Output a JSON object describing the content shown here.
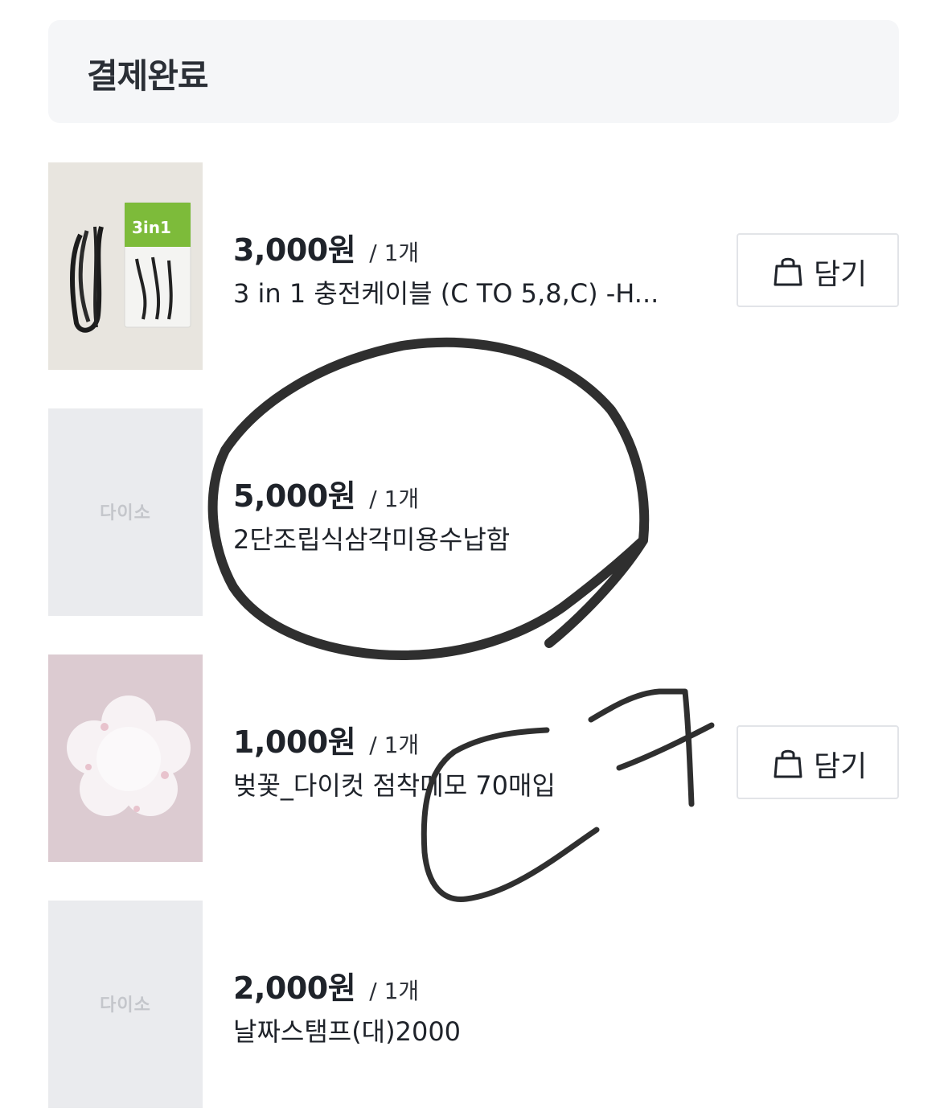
{
  "header": {
    "status_title": "결제완료"
  },
  "brand_placeholder": "다이소",
  "items": [
    {
      "price": "3,000원",
      "quantity": "/ 1개",
      "name": "3 in 1 충전케이블 (C TO 5,8,C) -H...",
      "thumbnail": "cable-product-photo",
      "cart_label": "담기"
    },
    {
      "price": "5,000원",
      "quantity": "/ 1개",
      "name": "2단조립식삼각미용수납함",
      "thumbnail": "brand-placeholder"
    },
    {
      "price": "1,000원",
      "quantity": "/ 1개",
      "name": "벚꽃_다이컷 점착메모 70매입",
      "thumbnail": "cherry-blossom-memo-photo",
      "cart_label": "담기"
    },
    {
      "price": "2,000원",
      "quantity": "/ 1개",
      "name": "날짜스탬프(대)2000",
      "thumbnail": "brand-placeholder"
    }
  ],
  "icons": {
    "cart": "shopping-bag-icon"
  },
  "colors": {
    "header_bg": "#f5f6f8",
    "annotation_ink": "#2f2f2f"
  }
}
